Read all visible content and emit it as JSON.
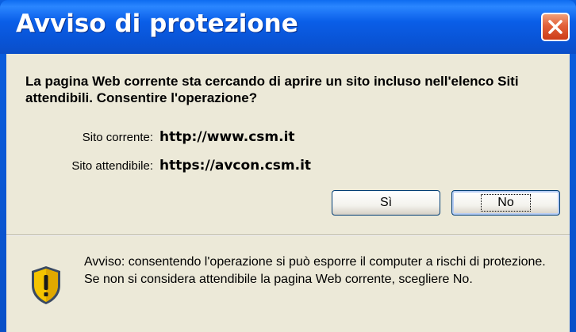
{
  "dialog": {
    "title": "Avviso di protezione",
    "question": "La pagina Web corrente sta cercando di aprire un sito incluso nell'elenco Siti attendibili. Consentire l'operazione?",
    "current_site": {
      "label": "Sito corrente:",
      "value": "http://www.csm.it"
    },
    "trusted_site": {
      "label": "Sito attendibile:",
      "value": "https://avcon.csm.it"
    },
    "buttons": {
      "yes": "Sì",
      "no": "No"
    },
    "warning": "Avviso: consentendo l'operazione si può esporre il computer a rischi di protezione. Se non si considera attendibile la pagina Web corrente, scegliere No."
  },
  "icons": {
    "close": "close-icon",
    "shield": "shield-warning-icon"
  },
  "colors": {
    "titlebar": "#0a5ee8",
    "client_background": "#ece9d8",
    "close_button": "#e2603a",
    "shield_yellow": "#f5c400"
  }
}
